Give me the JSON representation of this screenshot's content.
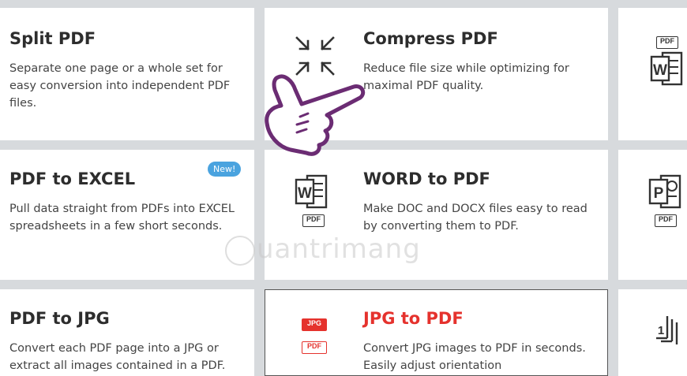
{
  "cards": {
    "split": {
      "title": "Split PDF",
      "desc": "Separate one page or a whole set for easy conversion into independent PDF files."
    },
    "compress": {
      "title": "Compress PDF",
      "desc": "Reduce file size while optimizing for maximal PDF quality."
    },
    "excel": {
      "title": "PDF to EXCEL",
      "desc": "Pull data straight from PDFs into EXCEL spreadsheets in a few short seconds.",
      "badge": "New!"
    },
    "word": {
      "title": "WORD to PDF",
      "desc": "Make DOC and DOCX files easy to read by converting them to PDF."
    },
    "jpg": {
      "title": "PDF to JPG",
      "desc": "Convert each PDF page into a JPG or extract all images contained in a PDF."
    },
    "jpgtopdf": {
      "title": "JPG to PDF",
      "desc": "Convert JPG images to PDF in seconds. Easily adjust orientation"
    }
  },
  "icon_labels": {
    "pdf": "PDF",
    "jpg": "JPG",
    "word_letter": "W",
    "ppt_letter": "P",
    "num": "1"
  },
  "watermark": "uantrimang",
  "colors": {
    "accent_red": "#e5322d",
    "badge_blue": "#4aa3df",
    "hand_purple": "#6b2c73"
  }
}
